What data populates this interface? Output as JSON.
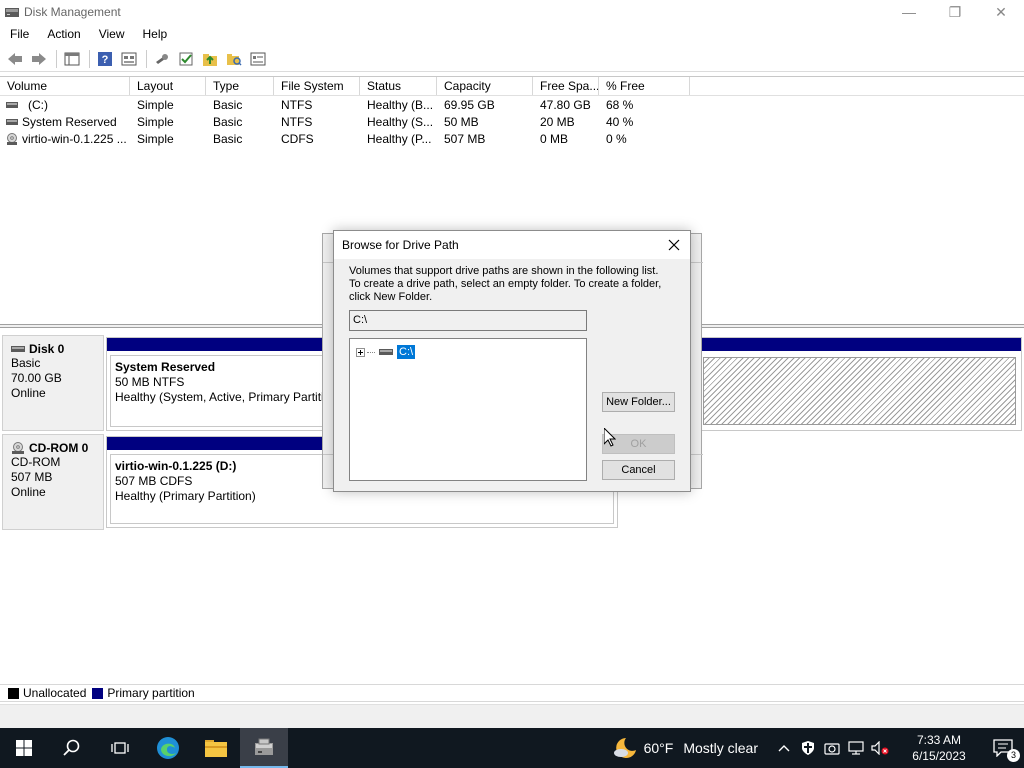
{
  "window": {
    "title": "Disk Management",
    "minimize": "—",
    "restore": "❐",
    "close": "✕"
  },
  "menu": [
    "File",
    "Action",
    "View",
    "Help"
  ],
  "columns": [
    {
      "label": "Volume",
      "w": 130
    },
    {
      "label": "Layout",
      "w": 76
    },
    {
      "label": "Type",
      "w": 68
    },
    {
      "label": "File System",
      "w": 86
    },
    {
      "label": "Status",
      "w": 77
    },
    {
      "label": "Capacity",
      "w": 96
    },
    {
      "label": "Free Spa...",
      "w": 66
    },
    {
      "label": "% Free",
      "w": 91
    }
  ],
  "volumes": [
    {
      "icon": "drive",
      "cells": [
        "(C:)",
        "Simple",
        "Basic",
        "NTFS",
        "Healthy (B...",
        "69.95 GB",
        "47.80 GB",
        "68 %"
      ]
    },
    {
      "icon": "drive",
      "cells": [
        "System Reserved",
        "Simple",
        "Basic",
        "NTFS",
        "Healthy (S...",
        "50 MB",
        "20 MB",
        "40 %"
      ]
    },
    {
      "icon": "cdrom",
      "cells": [
        "virtio-win-0.1.225 ...",
        "Simple",
        "Basic",
        "CDFS",
        "Healthy (P...",
        "507 MB",
        "0 MB",
        "0 %"
      ]
    }
  ],
  "disks": {
    "disk0": {
      "name": "Disk 0",
      "type": "Basic",
      "size": "70.00 GB",
      "state": "Online",
      "partition": {
        "name": "System Reserved",
        "size": "50 MB NTFS",
        "status": "Healthy (System, Active, Primary Partition)"
      }
    },
    "cdrom0": {
      "name": "CD-ROM 0",
      "type": "CD-ROM",
      "size": "507 MB",
      "state": "Online",
      "partition": {
        "name": "virtio-win-0.1.225  (D:)",
        "size": "507 MB CDFS",
        "status": "Healthy (Primary Partition)"
      }
    }
  },
  "legend": {
    "unallocated": "Unallocated",
    "primary": "Primary partition"
  },
  "colors": {
    "primary": "#000080",
    "unallocated": "#000000",
    "selection": "#0078d7"
  },
  "dialog": {
    "title": "Browse for Drive Path",
    "description_1": "Volumes that support drive paths are shown in the following list.",
    "description_2": "To create a drive path, select an empty folder. To create a folder,",
    "description_3": "click New Folder.",
    "path_value": "C:\\",
    "tree_item": "C:\\",
    "new_folder": "New Folder...",
    "ok": "OK",
    "cancel": "Cancel"
  },
  "taskbar": {
    "weather_temp": "60°F",
    "weather_text": "Mostly clear",
    "time": "7:33 AM",
    "date": "6/15/2023",
    "notification_count": "3"
  }
}
